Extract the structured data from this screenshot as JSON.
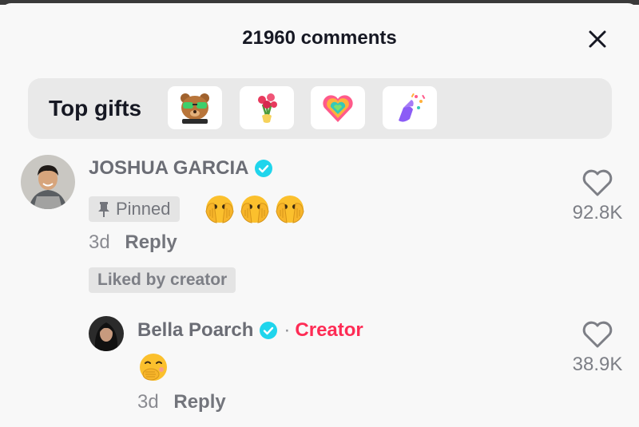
{
  "header": {
    "comment_count_text": "21960 comments"
  },
  "top_gifts": {
    "label": "Top gifts",
    "items": [
      "bear-glasses-gift-icon",
      "rose-bouquet-gift-icon",
      "rainbow-heart-gift-icon",
      "confetti-hand-gift-icon"
    ]
  },
  "comments": [
    {
      "author": "JOSHUA GARCIA",
      "verified": true,
      "pinned_label": "Pinned",
      "emojis": [
        "🫣",
        "🫣",
        "🫣"
      ],
      "time": "3d",
      "reply_label": "Reply",
      "liked_label": "Liked by creator",
      "likes": "92.8K"
    }
  ],
  "replies": [
    {
      "author": "Bella Poarch",
      "verified": true,
      "separator": "·",
      "role": "Creator",
      "emoji": "🤭",
      "time": "3d",
      "reply_label": "Reply",
      "likes": "38.9K"
    }
  ],
  "colors": {
    "verified": "#20d5ec",
    "creator": "#fe2c55",
    "background": "#f8f8f8",
    "gifts_bar": "#e9e9e9"
  }
}
